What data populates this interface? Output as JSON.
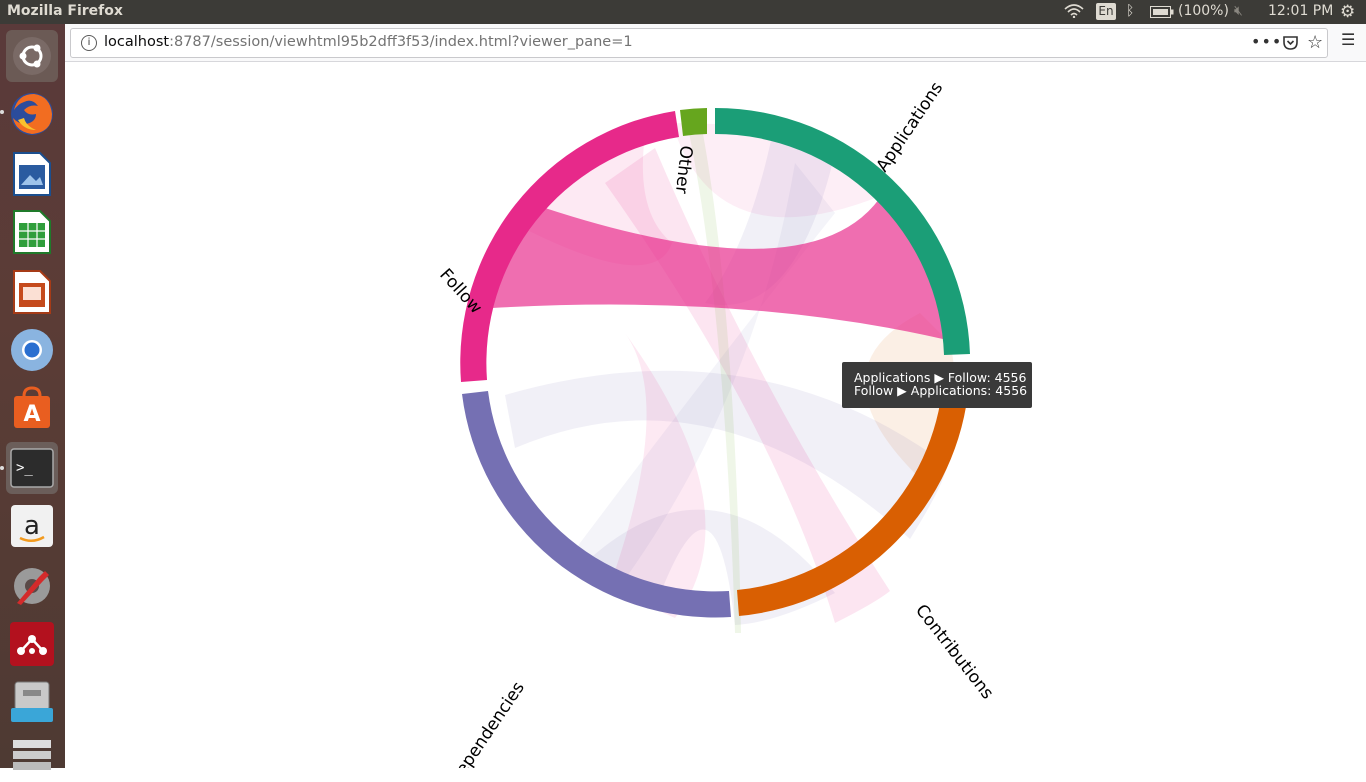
{
  "window": {
    "title": "Mozilla Firefox"
  },
  "panel": {
    "keyboard_layout": "En",
    "battery": "(100%)",
    "clock": "12:01 PM"
  },
  "launcher": {
    "items": [
      "ubuntu-dash",
      "firefox",
      "libreoffice-writer",
      "libreoffice-calc",
      "libreoffice-impress",
      "chromium",
      "software-center",
      "terminal",
      "amazon",
      "system-settings",
      "mendeley",
      "files-manager",
      "workspace-switcher"
    ]
  },
  "browser": {
    "url_host": "localhost",
    "url_path": ":8787/session/viewhtml95b2dff3f53/index.html?viewer_pane=1"
  },
  "chart_data": {
    "type": "chord",
    "groups": [
      {
        "name": "Applications",
        "color": "#1b9e77"
      },
      {
        "name": "Contributions",
        "color": "#d95f02"
      },
      {
        "name": "Dependencies",
        "color": "#7570b3"
      },
      {
        "name": "Follow",
        "color": "#e7298a"
      },
      {
        "name": "Other",
        "color": "#66a61e"
      }
    ],
    "highlighted": {
      "source": "Applications",
      "target": "Follow",
      "value": 4556
    }
  },
  "tooltip": {
    "line1": "Applications ▶ Follow: 4556",
    "line2": "Follow ▶ Applications: 4556"
  }
}
